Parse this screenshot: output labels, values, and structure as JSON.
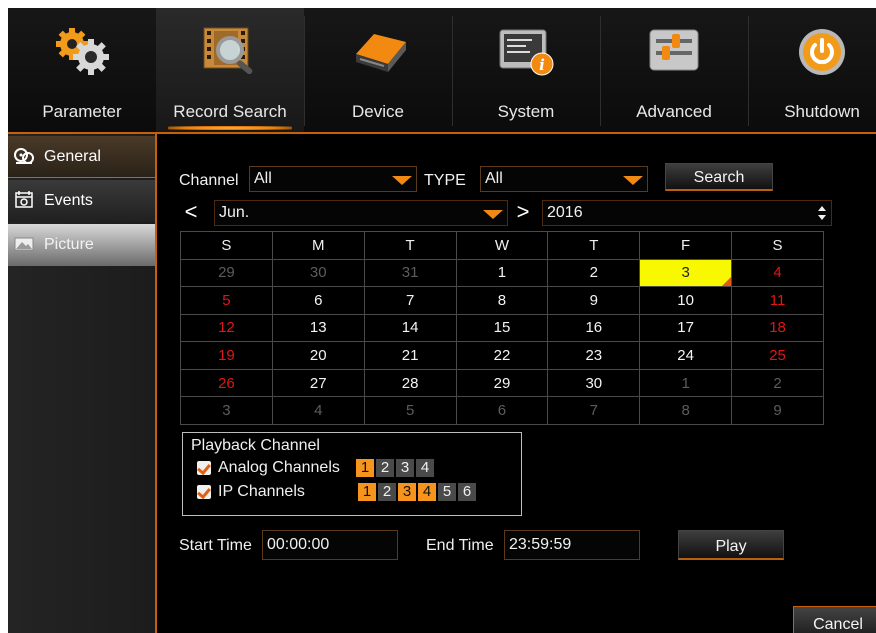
{
  "nav": {
    "items": [
      {
        "label": "Parameter",
        "icon": "gears-icon"
      },
      {
        "label": "Record Search",
        "icon": "film-search-icon"
      },
      {
        "label": "Device",
        "icon": "hard-drive-icon"
      },
      {
        "label": "System",
        "icon": "system-info-icon"
      },
      {
        "label": "Advanced",
        "icon": "sliders-icon"
      },
      {
        "label": "Shutdown",
        "icon": "power-icon"
      }
    ],
    "active": "Record Search"
  },
  "sidebar": {
    "items": [
      {
        "label": "General",
        "icon": "reel-icon",
        "state": "active"
      },
      {
        "label": "Events",
        "icon": "event-icon",
        "state": "normal"
      },
      {
        "label": "Picture",
        "icon": "picture-icon",
        "state": "dimmed"
      }
    ]
  },
  "search": {
    "channel_label": "Channel",
    "channel_value": "All",
    "type_label": "TYPE",
    "type_value": "All",
    "search_button": "Search"
  },
  "calendar": {
    "prev_symbol": "<",
    "next_symbol": ">",
    "month": "Jun.",
    "year": "2016",
    "weekdays": [
      "S",
      "M",
      "T",
      "W",
      "T",
      "F",
      "S"
    ],
    "weeks": [
      [
        "29",
        "30",
        "31",
        "1",
        "2",
        "3",
        "4"
      ],
      [
        "5",
        "6",
        "7",
        "8",
        "9",
        "10",
        "11"
      ],
      [
        "12",
        "13",
        "14",
        "15",
        "16",
        "17",
        "18"
      ],
      [
        "19",
        "20",
        "21",
        "22",
        "23",
        "24",
        "25"
      ],
      [
        "26",
        "27",
        "28",
        "29",
        "30",
        "1",
        "2"
      ],
      [
        "3",
        "4",
        "5",
        "6",
        "7",
        "8",
        "9"
      ]
    ],
    "selected_day": "3",
    "highlight_color": "#f8f800",
    "weekend_color": "#e01616"
  },
  "playback": {
    "title": "Playback Channel",
    "analog_label": "Analog Channels",
    "analog_checked": true,
    "analog_channels": [
      {
        "num": "1",
        "selected": true
      },
      {
        "num": "2",
        "selected": false
      },
      {
        "num": "3",
        "selected": false
      },
      {
        "num": "4",
        "selected": false
      }
    ],
    "ip_label": "IP Channels",
    "ip_checked": true,
    "ip_channels": [
      {
        "num": "1",
        "selected": true
      },
      {
        "num": "2",
        "selected": false
      },
      {
        "num": "3",
        "selected": true
      },
      {
        "num": "4",
        "selected": true
      },
      {
        "num": "5",
        "selected": false
      },
      {
        "num": "6",
        "selected": false
      }
    ]
  },
  "time": {
    "start_label": "Start Time",
    "start_value": "00:00:00",
    "end_label": "End Time",
    "end_value": "23:59:59",
    "play_button": "Play"
  },
  "footer": {
    "cancel_button": "Cancel"
  },
  "colors": {
    "accent": "#f7941d",
    "border_accent": "#c8600a"
  }
}
